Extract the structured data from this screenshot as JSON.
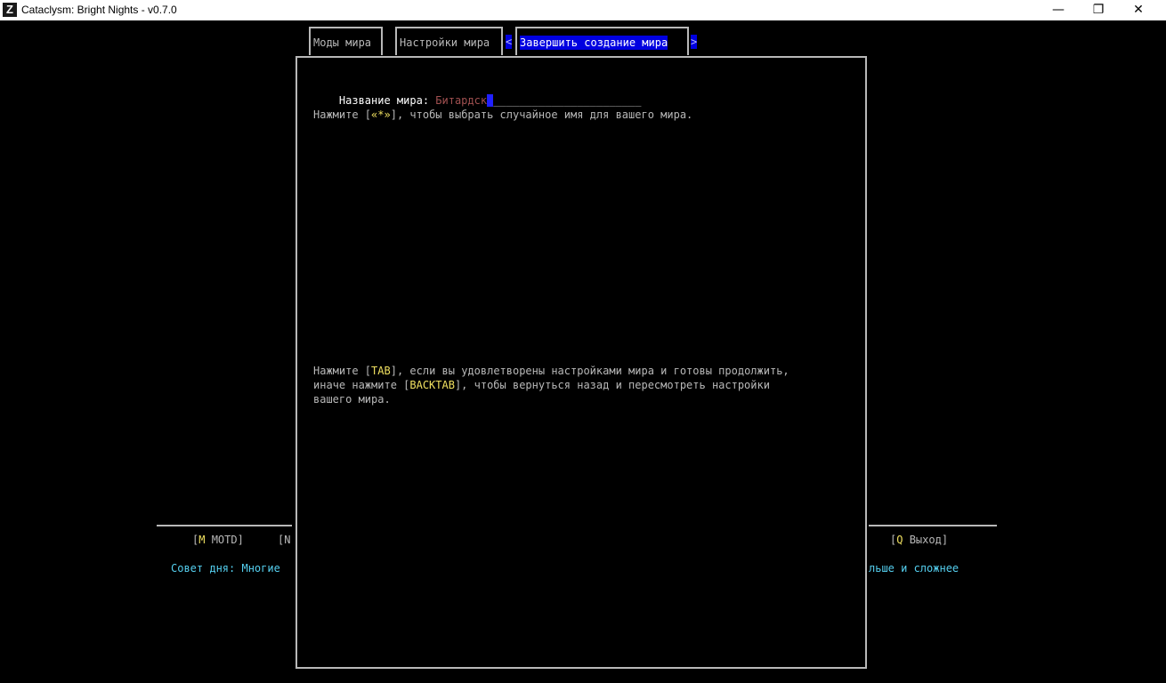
{
  "window": {
    "title": "Cataclysm: Bright Nights - v0.7.0",
    "icon_letter": "Z",
    "minimize": "—",
    "restore": "❐",
    "close": "✕"
  },
  "tabs": {
    "mods": "Моды мира",
    "settings": "Настройки мира",
    "finish": "Завершить создание мира",
    "left_arrow": "<",
    "right_arrow": ">"
  },
  "dialog": {
    "name_label": "Название мира: ",
    "name_value": "Битардск",
    "name_underline": "_______________________",
    "random_line": {
      "before": "Нажмите [",
      "key": "«*»",
      "after": "], чтобы выбрать случайное имя для вашего мира."
    },
    "confirm_line1": {
      "before": "Нажмите [",
      "key": "TAB",
      "after": "], если вы удовлетворены настройками мира и готовы продолжить,"
    },
    "confirm_line2": {
      "before": "иначе нажмите [",
      "key": "BACKTAB",
      "after": "], чтобы вернуться назад и пересмотреть настройки"
    },
    "confirm_line3": "вашего мира."
  },
  "background": {
    "motd": {
      "open": "[",
      "key": "M",
      "label": " MOTD]"
    },
    "partial_hint": "[N",
    "quit": {
      "open": "[",
      "key": "Q",
      "label": " Выход]"
    },
    "tip_left": "Совет дня: Многие",
    "tip_right": "льше и сложнее"
  },
  "colors": {
    "border": "#b8b8b8",
    "selected_tab_bg": "#0000e0",
    "name_value": "#a05050",
    "key_highlight": "#f0e060",
    "tip": "#55d0f0",
    "cursor": "#2020ff"
  }
}
